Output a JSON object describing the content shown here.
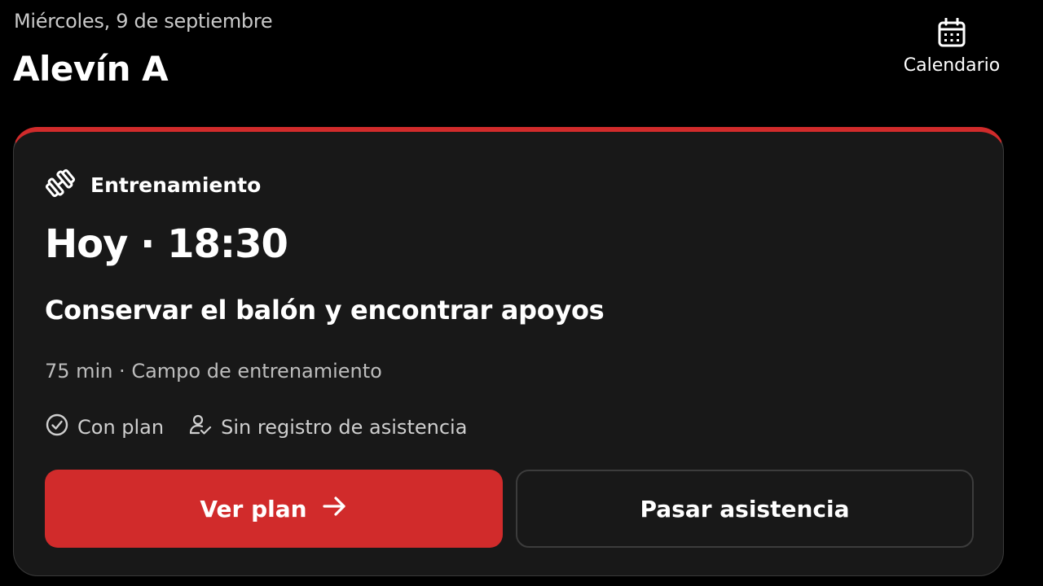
{
  "header": {
    "date": "Miércoles, 9 de septiembre",
    "team": "Alevín A",
    "calendar_label": "Calendario",
    "calendar_icon": "calendar-icon"
  },
  "card": {
    "accent_color": "#d12b2b",
    "type_icon": "dumbbell-icon",
    "type_label": "Entrenamiento",
    "when": "Hoy · 18:30",
    "title": "Conservar el balón y encontrar apoyos",
    "meta": "75 min · Campo de entrenamiento",
    "badges": {
      "plan": {
        "icon": "check-circle-icon",
        "label": "Con plan"
      },
      "attendance": {
        "icon": "user-check-icon",
        "label": "Sin registro de asistencia"
      }
    },
    "actions": {
      "primary_label": "Ver plan",
      "primary_icon": "arrow-right-icon",
      "secondary_label": "Pasar asistencia"
    }
  }
}
